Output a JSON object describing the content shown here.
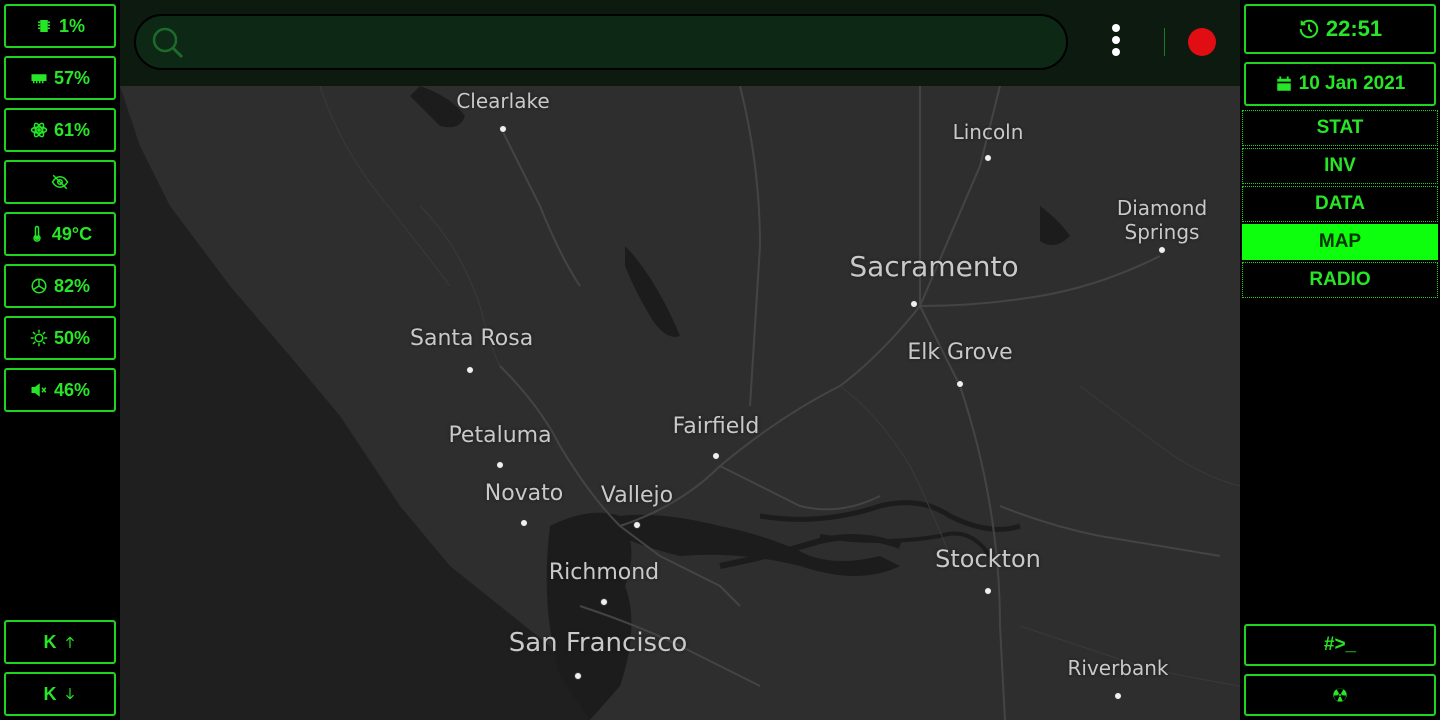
{
  "stats": [
    {
      "icon": "cpu-icon",
      "value": "1%"
    },
    {
      "icon": "ram-icon",
      "value": "57%"
    },
    {
      "icon": "atom-icon",
      "value": "61%"
    },
    {
      "icon": "eye-off-icon",
      "value": ""
    },
    {
      "icon": "thermometer-icon",
      "value": "49°C"
    },
    {
      "icon": "fan-icon",
      "value": "82%"
    },
    {
      "icon": "brightness-icon",
      "value": "50%"
    },
    {
      "icon": "volume-mute-icon",
      "value": "46%"
    }
  ],
  "keyboard": {
    "up_label": "K",
    "down_label": "K"
  },
  "clock": {
    "time": "22:51",
    "date": "10 Jan 2021"
  },
  "nav": {
    "items": [
      "STAT",
      "INV",
      "DATA",
      "MAP",
      "RADIO"
    ],
    "active": "MAP"
  },
  "terminal": {
    "label": "#>_"
  },
  "search": {
    "placeholder": ""
  },
  "map": {
    "cities": [
      {
        "name": "Clearlake"
      },
      {
        "name": "Lincoln"
      },
      {
        "name": "Diamond Springs"
      },
      {
        "name": "Sacramento"
      },
      {
        "name": "Santa Rosa"
      },
      {
        "name": "Elk Grove"
      },
      {
        "name": "Fairfield"
      },
      {
        "name": "Petaluma"
      },
      {
        "name": "Novato"
      },
      {
        "name": "Vallejo"
      },
      {
        "name": "Richmond"
      },
      {
        "name": "Stockton"
      },
      {
        "name": "San Francisco"
      },
      {
        "name": "Riverbank"
      }
    ]
  },
  "colors": {
    "accent": "#27e627",
    "active_nav": "#0dff0d",
    "record": "#e00d12",
    "map_bg": "#2e2e2e"
  }
}
